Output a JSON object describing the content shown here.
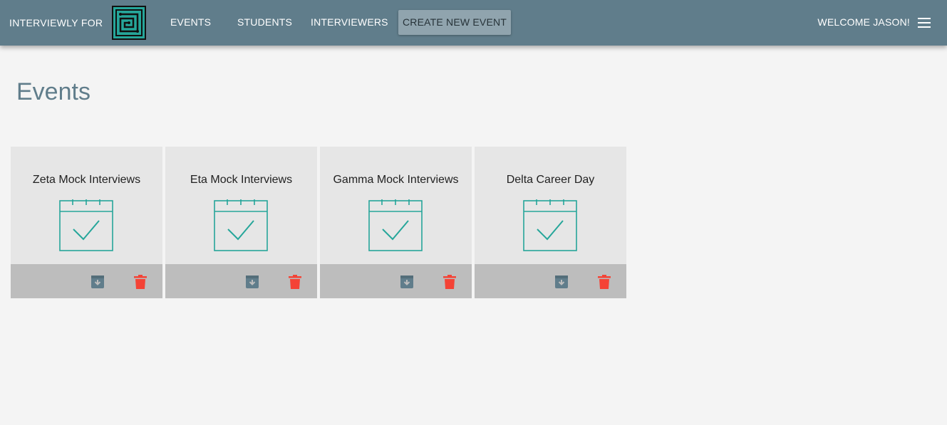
{
  "header": {
    "brand": "INTERVIEWLY FOR",
    "nav": [
      {
        "label": "EVENTS"
      },
      {
        "label": "STUDENTS"
      },
      {
        "label": "INTERVIEWERS"
      },
      {
        "label": "CREATE NEW EVENT"
      }
    ],
    "welcome": "WELCOME JASON!"
  },
  "main": {
    "title": "Events",
    "events": [
      {
        "name": "Zeta Mock Interviews"
      },
      {
        "name": "Eta Mock Interviews"
      },
      {
        "name": "Gamma Mock Interviews"
      },
      {
        "name": "Delta Career Day"
      }
    ]
  },
  "colors": {
    "header_bg": "#607d8b",
    "accent_teal": "#26a69a",
    "delete_red": "#f44336",
    "archive_gray": "#607d8b"
  },
  "icons": {
    "logo": "circuit-logo-icon",
    "menu": "hamburger-menu-icon",
    "event": "calendar-check-icon",
    "archive": "archive-icon",
    "delete": "trash-icon"
  }
}
